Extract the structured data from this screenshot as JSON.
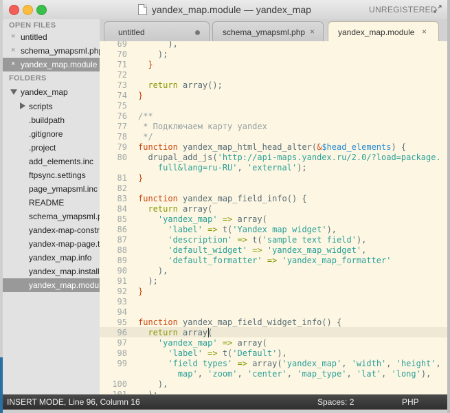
{
  "window": {
    "title": "yandex_map.module — yandex_map",
    "unregistered": "UNREGISTERED"
  },
  "sidebar": {
    "open_files_header": "OPEN FILES",
    "open_files": [
      {
        "label": "untitled"
      },
      {
        "label": "schema_ymapsml.php"
      },
      {
        "label": "yandex_map.module"
      }
    ],
    "folders_header": "FOLDERS",
    "root_folder": "yandex_map",
    "tree": [
      {
        "label": "scripts"
      },
      {
        "label": ".buildpath"
      },
      {
        "label": ".gitignore"
      },
      {
        "label": ".project"
      },
      {
        "label": "add_elements.inc"
      },
      {
        "label": "ftpsync.settings"
      },
      {
        "label": "page_ymapsml.inc"
      },
      {
        "label": "README"
      },
      {
        "label": "schema_ymapsml.php"
      },
      {
        "label": "yandex-map-constructor"
      },
      {
        "label": "yandex-map-page.tpl.php"
      },
      {
        "label": "yandex_map.info"
      },
      {
        "label": "yandex_map.install"
      },
      {
        "label": "yandex_map.module"
      }
    ]
  },
  "tabs": [
    {
      "label": "untitled",
      "modified": true
    },
    {
      "label": "schema_ymapsml.php",
      "close": "×"
    },
    {
      "label": "yandex_map.module",
      "close": "×"
    }
  ],
  "editor": {
    "line_numbers": [
      "69",
      "70",
      "71",
      "72",
      "73",
      "74",
      "75",
      "76",
      "77",
      "78",
      "79",
      "80",
      "",
      "81",
      "82",
      "83",
      "84",
      "85",
      "86",
      "87",
      "88",
      "89",
      "90",
      "91",
      "92",
      "93",
      "94",
      "95",
      "96",
      "97",
      "98",
      "99",
      "",
      "100",
      "101"
    ],
    "code": {
      "l69": "      ),",
      "l70": "    );",
      "l71": "  }",
      "l73_kw": "return",
      "l73_rest": " array();",
      "l74": "}",
      "l76": "/**",
      "l77": " * Подключаем карту yandex",
      "l78": " */",
      "l79_kw": "function",
      "l79_fn": " yandex_map_html_head_alter(",
      "l79_amp": "&",
      "l79_var": "$head_elements",
      "l79_end": ") {",
      "l80_fn": "  drupal_add_js(",
      "l80_str": "'http://api-maps.yandex.ru/2.0/?load=package.",
      "l80b_str": "    full&lang=ru-RU'",
      "l80b_mid": ", ",
      "l80b_str2": "'external'",
      "l80b_end": ");",
      "l81": "}",
      "l83_kw": "function",
      "l83_fn": " yandex_map_field_info() {",
      "l84_kw": "  return",
      "l84_rest": " array(",
      "l85_str": "    'yandex_map'",
      "l85_op": " =>",
      "l85_rest": " array(",
      "l86_str": "      'label'",
      "l86_op": " =>",
      "l86_fn": " t(",
      "l86_str2": "'Yandex map widget'",
      "l86_end": "),",
      "l87_str": "      'description'",
      "l87_op": " =>",
      "l87_fn": " t(",
      "l87_str2": "'sample text field'",
      "l87_end": "),",
      "l88_str": "      'default_widget'",
      "l88_op": " =>",
      "l88_str2": " 'yandex_map_widget'",
      "l88_end": ",",
      "l89_str": "      'default_formatter'",
      "l89_op": " =>",
      "l89_str2": " 'yandex_map_formatter'",
      "l90": "    ),",
      "l91": "  );",
      "l92": "}",
      "l95_kw": "function",
      "l95_fn": " yandex_map_field_widget_info() {",
      "l96_kw": "  return",
      "l96_rest": " array(",
      "l97_str": "    'yandex_map'",
      "l97_op": " =>",
      "l97_rest": " array(",
      "l98_str": "      'label'",
      "l98_op": " =>",
      "l98_fn": " t(",
      "l98_str2": "'Default'",
      "l98_end": "),",
      "l99_str": "      'field types'",
      "l99_op": " =>",
      "l99_fn": " array(",
      "l99_s1": "'yandex_map'",
      "l99_c1": ", ",
      "l99_s2": "'width'",
      "l99_c2": ", ",
      "l99_s3": "'height'",
      "l99_c3": ", ",
      "l99_s4": "'",
      "l99b_s1": "        map'",
      "l99b_c1": ", ",
      "l99b_s2": "'zoom'",
      "l99b_c2": ", ",
      "l99b_s3": "'center'",
      "l99b_c3": ", ",
      "l99b_s4": "'map_type'",
      "l99b_c4": ", ",
      "l99b_s5": "'lat'",
      "l99b_c5": ", ",
      "l99b_s6": "'long'",
      "l99b_end": "),",
      "l100": "    ),",
      "l101": "  );"
    }
  },
  "status": {
    "mode": "INSERT MODE, Line 96, Column 16",
    "spaces": "Spaces: 2",
    "syntax": "PHP"
  }
}
